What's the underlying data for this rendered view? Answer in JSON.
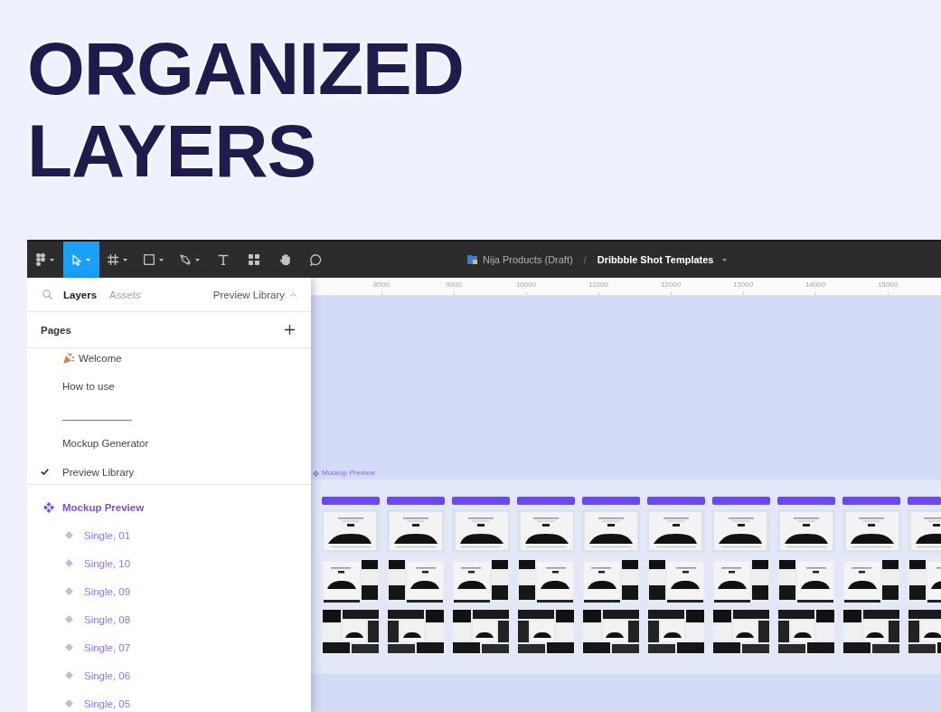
{
  "headline": "ORGANIZED LAYERS",
  "toolbar": {
    "tools": [
      {
        "kind": "menu",
        "selected": false,
        "dropdown": true
      },
      {
        "kind": "move",
        "selected": true,
        "dropdown": true
      },
      {
        "kind": "frame",
        "selected": false,
        "dropdown": true
      },
      {
        "kind": "shape",
        "selected": false,
        "dropdown": true
      },
      {
        "kind": "pen",
        "selected": false,
        "dropdown": true
      },
      {
        "kind": "text",
        "selected": false,
        "dropdown": false
      },
      {
        "kind": "components",
        "selected": false,
        "dropdown": false
      },
      {
        "kind": "hand",
        "selected": false,
        "dropdown": false
      },
      {
        "kind": "comment",
        "selected": false,
        "dropdown": false
      }
    ],
    "file_title": {
      "project": "Nija Products (Draft)",
      "separator": "/",
      "file": "Dribbble Shot Templates"
    }
  },
  "sidebar": {
    "tabs": [
      {
        "label": "Layers",
        "selected": true
      },
      {
        "label": "Assets",
        "selected": false
      }
    ],
    "current_page": "Preview Library",
    "pages_heading": "Pages",
    "pages": [
      {
        "name": "Welcome",
        "icon": true,
        "selected": false
      },
      {
        "name": "How to use",
        "icon": false,
        "selected": false
      },
      {
        "name": "____________",
        "icon": false,
        "selected": false
      },
      {
        "name": "Mockup Generator",
        "icon": false,
        "selected": false
      },
      {
        "name": "Preview Library",
        "icon": false,
        "selected": true
      }
    ],
    "layers": [
      {
        "name": "Mockup Preview",
        "kind": "component",
        "children": [
          {
            "name": "Single, 01",
            "kind": "instance"
          },
          {
            "name": "Single, 10",
            "kind": "instance"
          },
          {
            "name": "Single, 09",
            "kind": "instance"
          },
          {
            "name": "Single, 08",
            "kind": "instance"
          },
          {
            "name": "Single, 07",
            "kind": "instance"
          },
          {
            "name": "Single, 06",
            "kind": "instance"
          },
          {
            "name": "Single, 05",
            "kind": "instance"
          }
        ]
      }
    ]
  },
  "canvas": {
    "ruler": [
      "8000",
      "9000",
      "10000",
      "11000",
      "12000",
      "13000",
      "14000",
      "15000"
    ],
    "frame_label": "Mockup Preview"
  }
}
